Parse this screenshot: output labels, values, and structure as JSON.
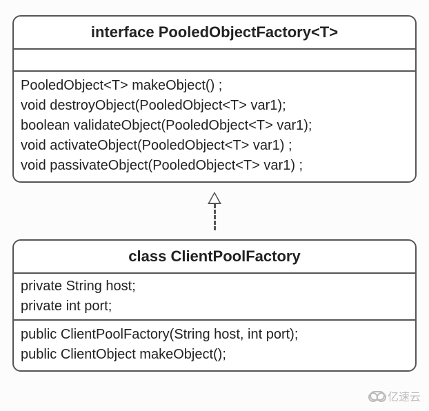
{
  "interface": {
    "title": "interface PooledObjectFactory<T>",
    "methods": [
      "PooledObject<T> makeObject() ;",
      "void destroyObject(PooledObject<T> var1);",
      "boolean validateObject(PooledObject<T> var1);",
      "void activateObject(PooledObject<T> var1) ;",
      "void passivateObject(PooledObject<T> var1) ;"
    ]
  },
  "class": {
    "title": "class ClientPoolFactory",
    "attributes": [
      "private String host;",
      "private int port;"
    ],
    "methods": [
      "public ClientPoolFactory(String host, int port);",
      "public ClientObject makeObject();"
    ]
  },
  "relationship": {
    "type": "realization",
    "from": "ClientPoolFactory",
    "to": "PooledObjectFactory<T>"
  },
  "watermark": "亿速云"
}
